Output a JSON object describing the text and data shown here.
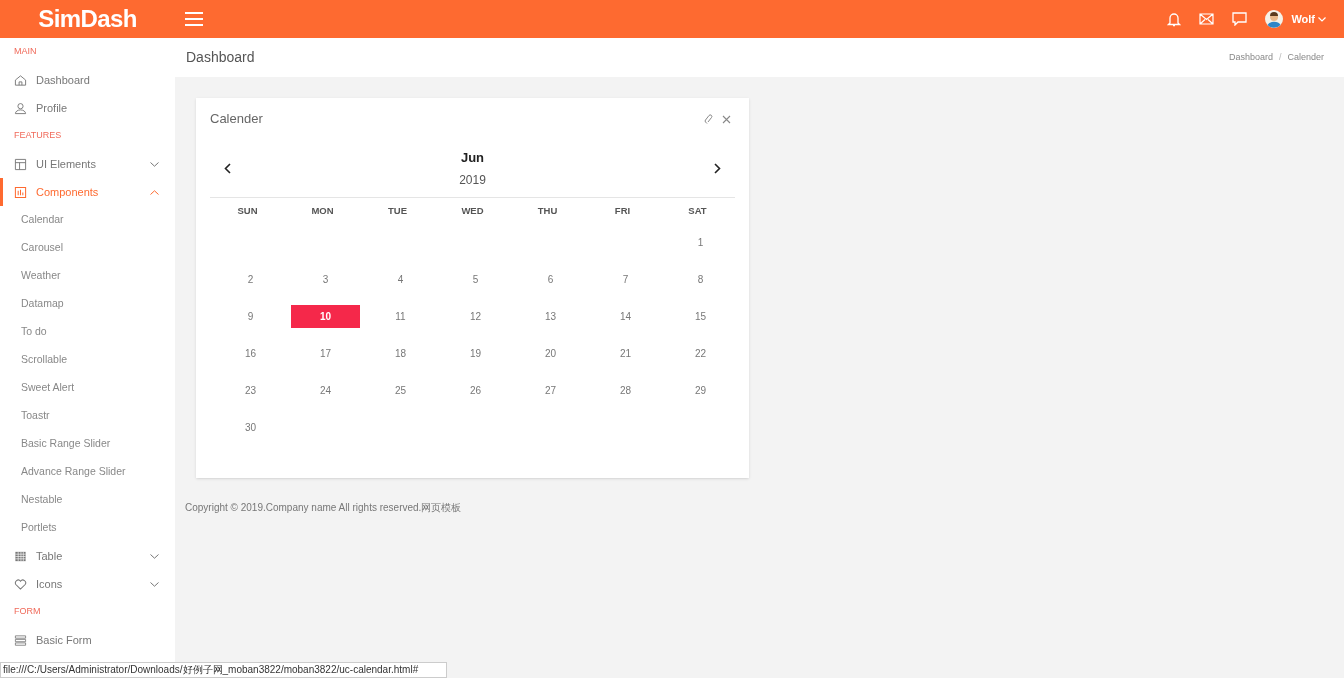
{
  "header": {
    "logo": "SimDash",
    "user": {
      "name": "Wolf"
    }
  },
  "sidebar": {
    "sections": [
      {
        "heading": "MAIN",
        "items": [
          {
            "label": "Dashboard",
            "selected": false
          },
          {
            "label": "Profile",
            "selected": false
          }
        ]
      },
      {
        "heading": "FEATURES",
        "items": [
          {
            "label": "UI Elements",
            "selected": false,
            "expanded": false
          },
          {
            "label": "Components",
            "selected": true,
            "expanded": true,
            "children": [
              {
                "label": "Calendar"
              },
              {
                "label": "Carousel"
              },
              {
                "label": "Weather"
              },
              {
                "label": "Datamap"
              },
              {
                "label": "To do"
              },
              {
                "label": "Scrollable"
              },
              {
                "label": "Sweet Alert"
              },
              {
                "label": "Toastr"
              },
              {
                "label": "Basic Range Slider"
              },
              {
                "label": "Advance Range Slider"
              },
              {
                "label": "Nestable"
              },
              {
                "label": "Portlets"
              }
            ]
          },
          {
            "label": "Table",
            "selected": false,
            "expanded": false
          },
          {
            "label": "Icons",
            "selected": false,
            "expanded": false
          }
        ]
      },
      {
        "heading": "FORM",
        "items": [
          {
            "label": "Basic Form",
            "selected": false
          }
        ]
      }
    ]
  },
  "page": {
    "title": "Dashboard",
    "breadcrumb": [
      "Dashboard",
      "Calender"
    ],
    "breadcrumb_separator": "/"
  },
  "card": {
    "title": "Calender",
    "calendar": {
      "month": "Jun",
      "year": "2019",
      "weekdays": [
        "SUN",
        "MON",
        "TUE",
        "WED",
        "THU",
        "FRI",
        "SAT"
      ],
      "weeks": [
        {
          "kind": "opening",
          "days": [
            {
              "day": "1",
              "selected": false
            }
          ]
        },
        {
          "kind": "week",
          "days": [
            {
              "day": "2",
              "selected": false
            },
            {
              "day": "3",
              "selected": false
            },
            {
              "day": "4",
              "selected": false
            },
            {
              "day": "5",
              "selected": false
            },
            {
              "day": "6",
              "selected": false
            },
            {
              "day": "7",
              "selected": false
            },
            {
              "day": "8",
              "selected": false
            }
          ]
        },
        {
          "kind": "week",
          "days": [
            {
              "day": "9",
              "selected": false
            },
            {
              "day": "10",
              "selected": true
            },
            {
              "day": "11",
              "selected": false
            },
            {
              "day": "12",
              "selected": false
            },
            {
              "day": "13",
              "selected": false
            },
            {
              "day": "14",
              "selected": false
            },
            {
              "day": "15",
              "selected": false
            }
          ]
        },
        {
          "kind": "week",
          "days": [
            {
              "day": "16",
              "selected": false
            },
            {
              "day": "17",
              "selected": false
            },
            {
              "day": "18",
              "selected": false
            },
            {
              "day": "19",
              "selected": false
            },
            {
              "day": "20",
              "selected": false
            },
            {
              "day": "21",
              "selected": false
            },
            {
              "day": "22",
              "selected": false
            }
          ]
        },
        {
          "kind": "week",
          "days": [
            {
              "day": "23",
              "selected": false
            },
            {
              "day": "24",
              "selected": false
            },
            {
              "day": "25",
              "selected": false
            },
            {
              "day": "26",
              "selected": false
            },
            {
              "day": "27",
              "selected": false
            },
            {
              "day": "28",
              "selected": false
            },
            {
              "day": "29",
              "selected": false
            }
          ]
        },
        {
          "kind": "week",
          "days": [
            {
              "day": "30",
              "selected": false
            }
          ]
        }
      ]
    }
  },
  "footer": "Copyright © 2019.Company name All rights reserved.网页模板",
  "status_bar": "file:///C:/Users/Administrator/Downloads/好例子网_moban3822/moban3822/uc-calendar.html#"
}
